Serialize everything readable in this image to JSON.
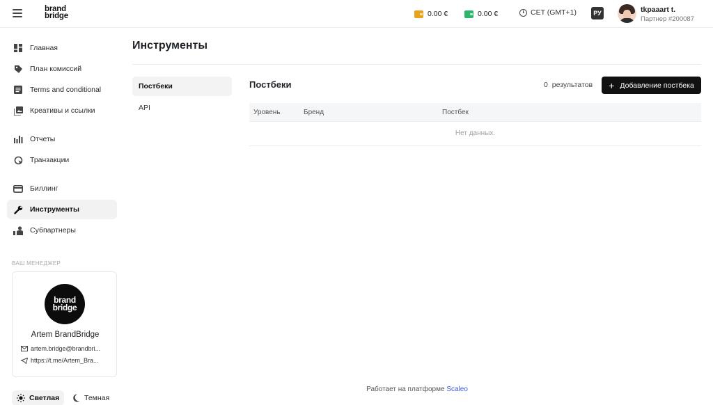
{
  "header": {
    "logo_line1": "brand",
    "logo_line2": "bridge",
    "balance_1": "0.00 €",
    "balance_1_color": "#e8a31b",
    "balance_2": "0.00 €",
    "balance_2_color": "#2cb56b",
    "timezone": "CET (GMT+1)",
    "language": "РУ",
    "user_name": "tkpaaart t.",
    "user_partner": "Партнер #200087"
  },
  "sidebar": {
    "items": [
      {
        "label": "Главная",
        "icon": "dashboard-icon"
      },
      {
        "label": "План комиссий",
        "icon": "tag-icon"
      },
      {
        "label": "Terms and conditional",
        "icon": "document-icon"
      },
      {
        "label": "Креативы и ссылки",
        "icon": "images-icon"
      },
      {
        "label": "Отчеты",
        "icon": "bar-chart-icon"
      },
      {
        "label": "Транзакции",
        "icon": "transactions-icon"
      },
      {
        "label": "Биллинг",
        "icon": "card-icon"
      },
      {
        "label": "Инструменты",
        "icon": "wrench-icon",
        "active": true
      },
      {
        "label": "Субпартнеры",
        "icon": "subpartners-icon"
      }
    ],
    "manager_title": "ВАШ МЕНЕДЖЕР",
    "manager": {
      "logo_line1": "brand",
      "logo_line2": "bridge",
      "name": "Artem BrandBridge",
      "email": "artem.bridge@brandbri...",
      "telegram": "https://t.me/Artem_Bra..."
    },
    "theme_light": "Светлая",
    "theme_dark": "Темная"
  },
  "main": {
    "title": "Инструменты",
    "subnav": [
      {
        "label": "Постбеки",
        "active": true
      },
      {
        "label": "API"
      }
    ],
    "section_title": "Постбеки",
    "results": "0 результатов",
    "add_button": "Добавление постбека",
    "table": {
      "columns": [
        "Уровень",
        "Бренд",
        "Постбек"
      ],
      "empty_text": "Нет данных."
    }
  },
  "footer": {
    "text": "Работает на платформе",
    "link": "Scaleo",
    "link_color": "#3d5bd9"
  }
}
